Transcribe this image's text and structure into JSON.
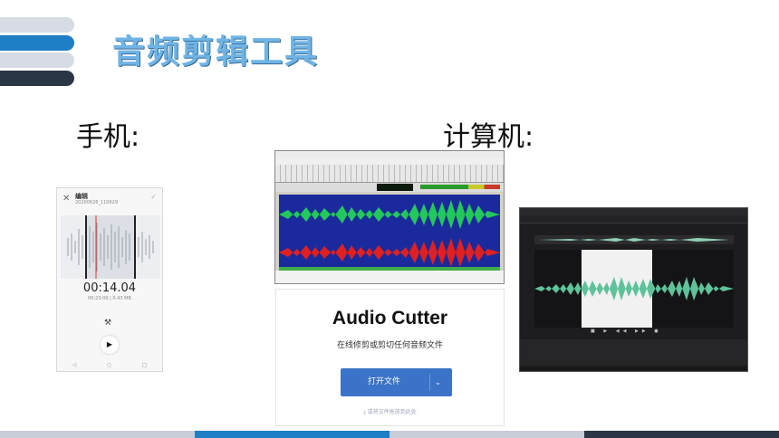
{
  "title": "音频剪辑工具",
  "labels": {
    "phone": "手机:",
    "computer": "计算机:"
  },
  "phone_app": {
    "header_title": "编辑",
    "header_sub": "20200626_110629",
    "time": "00:14.04",
    "info": "00:23:09  |  0.43 MB",
    "close_icon": "close-icon",
    "check_icon": "check-icon",
    "tool_icon": "tools-icon",
    "play_icon": "play-icon"
  },
  "audio_cutter": {
    "title": "Audio Cutter",
    "subtitle": "在线修剪或剪切任何音频文件",
    "open_button": "打开文件",
    "drop_hint": "或将文件拖放到此处"
  },
  "colors": {
    "title_blue": "#6fb4e6",
    "accent_blue": "#1e7ec6",
    "dark_bar": "#2b3646",
    "button_blue": "#3a73c7",
    "wave_green": "#22c85a",
    "wave_red": "#e02020",
    "dark_wave": "#5ec29a"
  }
}
